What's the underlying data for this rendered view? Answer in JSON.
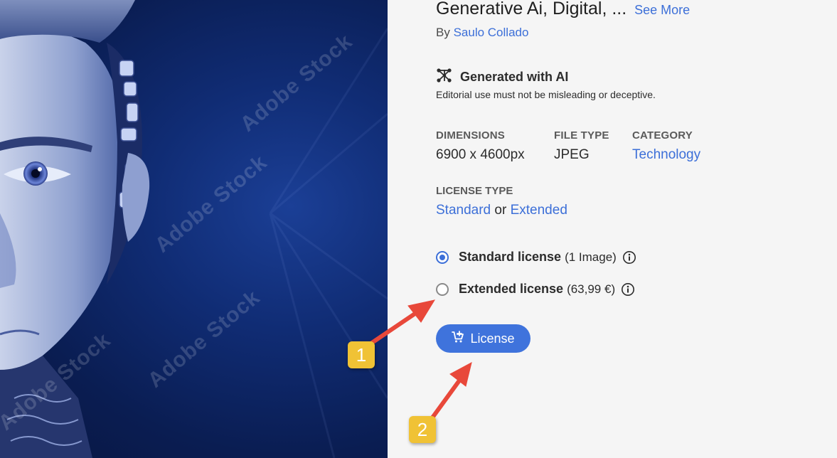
{
  "asset": {
    "title": "Generative Ai, Digital, ...",
    "see_more": "See More",
    "by_prefix": "By",
    "author": "Saulo Collado"
  },
  "ai_badge": {
    "label": "Generated with AI",
    "note": "Editorial use must not be misleading or deceptive."
  },
  "details": {
    "dimensions_label": "DIMENSIONS",
    "dimensions_value": "6900 x 4600px",
    "file_type_label": "FILE TYPE",
    "file_type_value": "JPEG",
    "category_label": "CATEGORY",
    "category_value": "Technology"
  },
  "license_type": {
    "label": "LICENSE TYPE",
    "standard": "Standard",
    "or": "or",
    "extended": "Extended"
  },
  "license_options": [
    {
      "name": "Standard license",
      "extra": "(1 Image)",
      "selected": true
    },
    {
      "name": "Extended license",
      "extra": "(63,99 €)",
      "selected": false
    }
  ],
  "license_button": {
    "label": "License",
    "icon": "cart-plus-icon"
  },
  "preview": {
    "watermark": "Adobe Stock"
  },
  "annotations": {
    "badge_1": "1",
    "badge_2": "2",
    "badge_color": "#f0c235",
    "arrow_color": "#e8483a"
  },
  "colors": {
    "accent": "#3f73dc",
    "link": "#3c6fd8",
    "panel_bg": "#f5f5f5"
  }
}
